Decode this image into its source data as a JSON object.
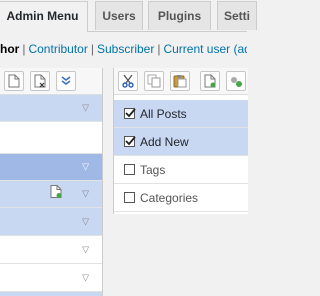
{
  "tabs": [
    {
      "label": "Admin Menu",
      "active": true
    },
    {
      "label": "Users",
      "active": false
    },
    {
      "label": "Plugins",
      "active": false
    },
    {
      "label": "Setti",
      "active": false
    }
  ],
  "roles": {
    "current": "hor",
    "links": [
      "Contributor",
      "Subscriber",
      "Current user (adr"
    ]
  },
  "left_panel": {
    "toolbar_icons": [
      "new-item-icon",
      "delete-item-icon",
      "collapse-all-icon"
    ],
    "rows": [
      {
        "state": "highlight",
        "expand_icon": "triangle-down-icon"
      },
      {
        "state": "plain"
      },
      {
        "state": "selected",
        "expand_icon": "triangle-down-icon"
      },
      {
        "state": "highlight",
        "expand_icon": "triangle-down-icon",
        "badge_icon": "add-page-icon"
      },
      {
        "state": "highlight",
        "expand_icon": "triangle-down-icon"
      },
      {
        "state": "plain",
        "expand_icon": "triangle-down-icon"
      },
      {
        "state": "plain",
        "expand_icon": "triangle-down-icon"
      },
      {
        "state": "highlight"
      }
    ]
  },
  "right_panel": {
    "toolbar_icons": [
      "cut-icon",
      "copy-icon",
      "paste-icon",
      "new-item-icon",
      "new-separator-icon"
    ],
    "items": [
      {
        "label": "All Posts",
        "checked": true
      },
      {
        "label": "Add New",
        "checked": true
      },
      {
        "label": "Tags",
        "checked": false
      },
      {
        "label": "Categories",
        "checked": false
      }
    ]
  },
  "colors": {
    "selected_row": "#9fb8e6",
    "highlight_row": "#c8d7f2",
    "link": "#0073aa"
  }
}
